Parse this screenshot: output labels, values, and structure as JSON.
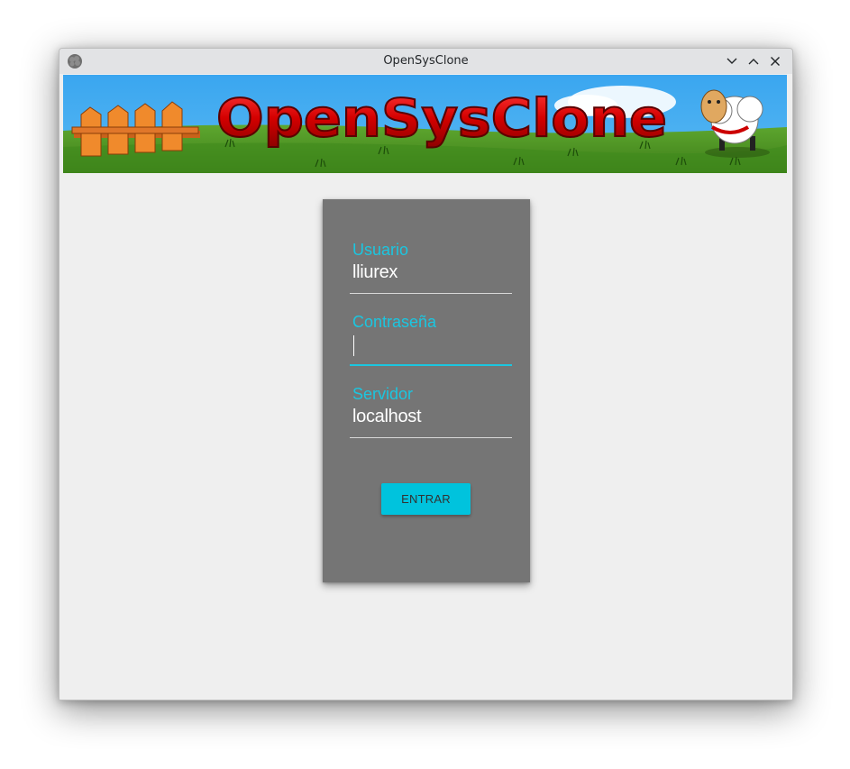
{
  "window": {
    "title": "OpenSysClone"
  },
  "banner": {
    "logo_text": "OpenSysClone"
  },
  "login": {
    "user_label": "Usuario",
    "user_value": "lliurex",
    "password_label": "Contraseña",
    "password_value": "",
    "server_label": "Servidor",
    "server_value": "localhost",
    "enter_label": "ENTRAR"
  },
  "icons": {
    "app": "sheep-icon",
    "minimize": "chevron-down-icon",
    "maximize": "chevron-up-icon",
    "close": "close-icon"
  },
  "colors": {
    "accent": "#1bc6e0",
    "button": "#00c3dd",
    "card": "#757575",
    "banner_sky": "#3ea9ee",
    "banner_grass": "#4b8f22",
    "logo_red": "#cc0000"
  }
}
